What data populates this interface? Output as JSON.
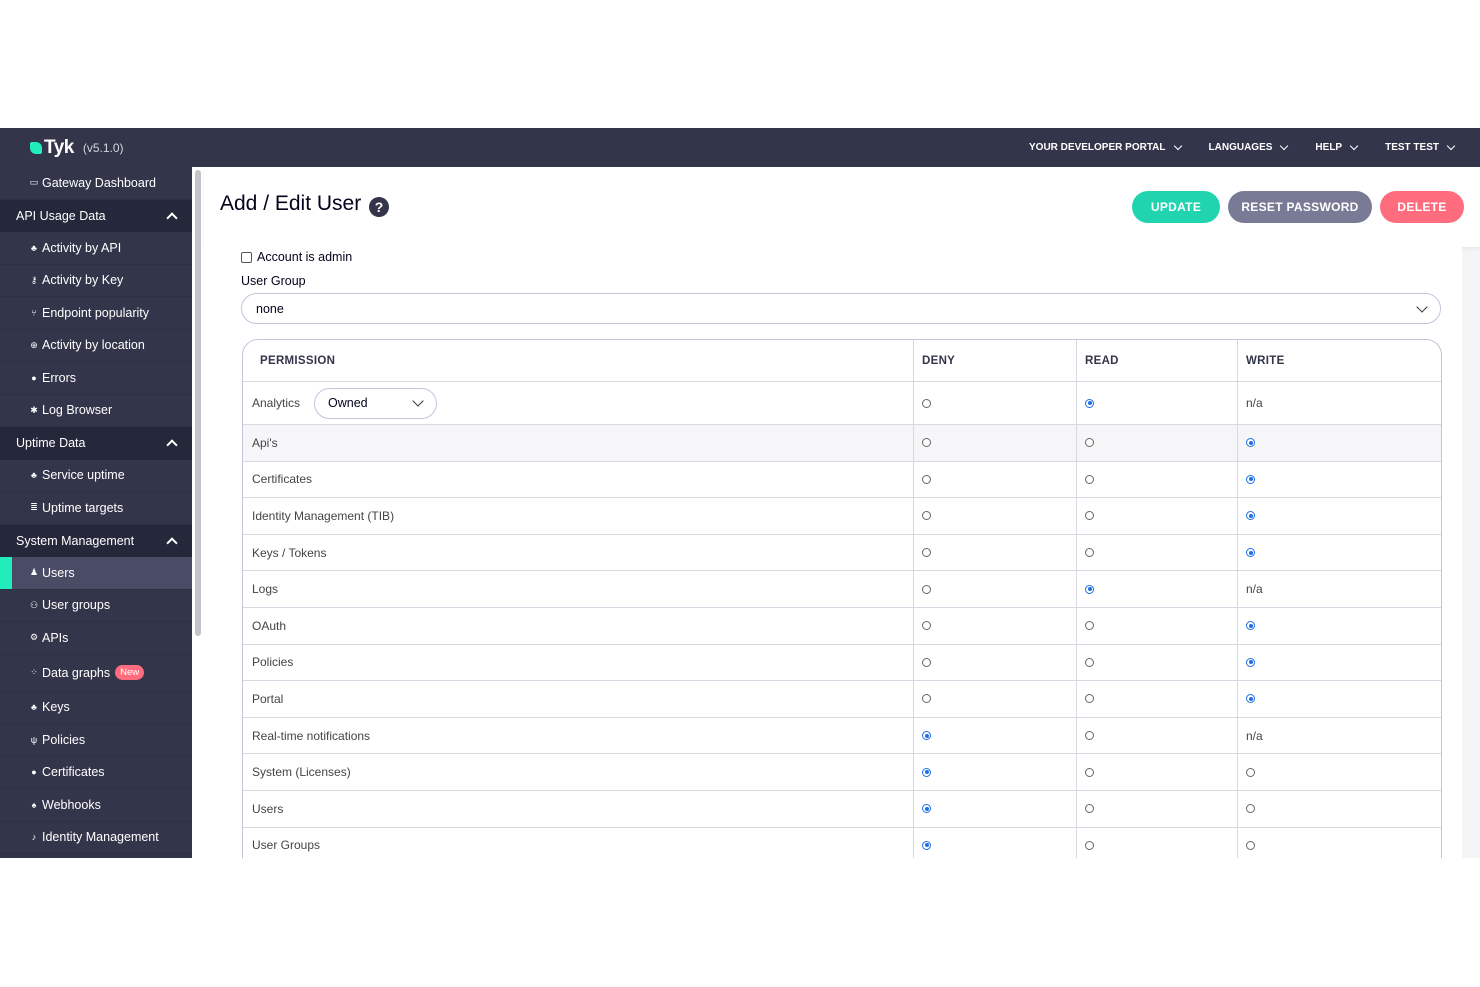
{
  "app": {
    "logo_text": "Tyk",
    "version": "(v5.1.0)"
  },
  "topnav": [
    {
      "label": "YOUR DEVELOPER PORTAL"
    },
    {
      "label": "LANGUAGES"
    },
    {
      "label": "HELP"
    },
    {
      "label": "TEST TEST"
    }
  ],
  "sidebar": {
    "gateway": {
      "icon": "monitor-icon",
      "label": "Gateway Dashboard"
    },
    "api_usage": {
      "title": "API Usage Data",
      "items": [
        {
          "icon": "activity-icon",
          "label": "Activity by API"
        },
        {
          "icon": "key-icon",
          "label": "Activity by Key"
        },
        {
          "icon": "branch-icon",
          "label": "Endpoint popularity"
        },
        {
          "icon": "globe-icon",
          "label": "Activity by location"
        },
        {
          "icon": "bug-icon",
          "label": "Errors"
        },
        {
          "icon": "log-icon",
          "label": "Log Browser"
        }
      ]
    },
    "uptime": {
      "title": "Uptime Data",
      "items": [
        {
          "icon": "activity-icon",
          "label": "Service uptime"
        },
        {
          "icon": "list-icon",
          "label": "Uptime targets"
        }
      ]
    },
    "system": {
      "title": "System Management",
      "items": [
        {
          "icon": "user-icon",
          "label": "Users"
        },
        {
          "icon": "users-icon",
          "label": "User groups"
        },
        {
          "icon": "apis-icon",
          "label": "APIs"
        },
        {
          "icon": "graph-icon",
          "label": "Data graphs",
          "badge": "New"
        },
        {
          "icon": "keys-icon",
          "label": "Keys"
        },
        {
          "icon": "policy-icon",
          "label": "Policies"
        },
        {
          "icon": "certificate-icon",
          "label": "Certificates"
        },
        {
          "icon": "bell-icon",
          "label": "Webhooks"
        },
        {
          "icon": "identity-icon",
          "label": "Identity Management"
        }
      ]
    }
  },
  "header": {
    "title": "Add / Edit User",
    "update_label": "UPDATE",
    "reset_label": "RESET PASSWORD",
    "delete_label": "DELETE"
  },
  "form": {
    "account_admin_label": "Account is admin",
    "account_admin_checked": false,
    "user_group_label": "User Group",
    "user_group_value": "none"
  },
  "permissions": {
    "headers": {
      "permission": "PERMISSION",
      "deny": "DENY",
      "read": "READ",
      "write": "WRITE"
    },
    "analytics_scope": "Owned",
    "rows": [
      {
        "name": "Analytics",
        "selected": "read",
        "write_na": true
      },
      {
        "name": "Api's",
        "selected": "write",
        "write_na": false
      },
      {
        "name": "Certificates",
        "selected": "write",
        "write_na": false
      },
      {
        "name": "Identity Management (TIB)",
        "selected": "write",
        "write_na": false
      },
      {
        "name": "Keys / Tokens",
        "selected": "write",
        "write_na": false
      },
      {
        "name": "Logs",
        "selected": "read",
        "write_na": true
      },
      {
        "name": "OAuth",
        "selected": "write",
        "write_na": false
      },
      {
        "name": "Policies",
        "selected": "write",
        "write_na": false
      },
      {
        "name": "Portal",
        "selected": "write",
        "write_na": false
      },
      {
        "name": "Real-time notifications",
        "selected": "deny",
        "write_na": true
      },
      {
        "name": "System (Licenses)",
        "selected": "deny",
        "write_na": false
      },
      {
        "name": "Users",
        "selected": "deny",
        "write_na": false
      },
      {
        "name": "User Groups",
        "selected": "deny",
        "write_na": false
      }
    ],
    "na_text": "n/a"
  },
  "colors": {
    "topbar": "#33354a",
    "accent_green": "#20d4b0",
    "reset_button": "#797b96",
    "delete_button": "#ff6c7d",
    "radio_selected": "#1f6fe5"
  }
}
